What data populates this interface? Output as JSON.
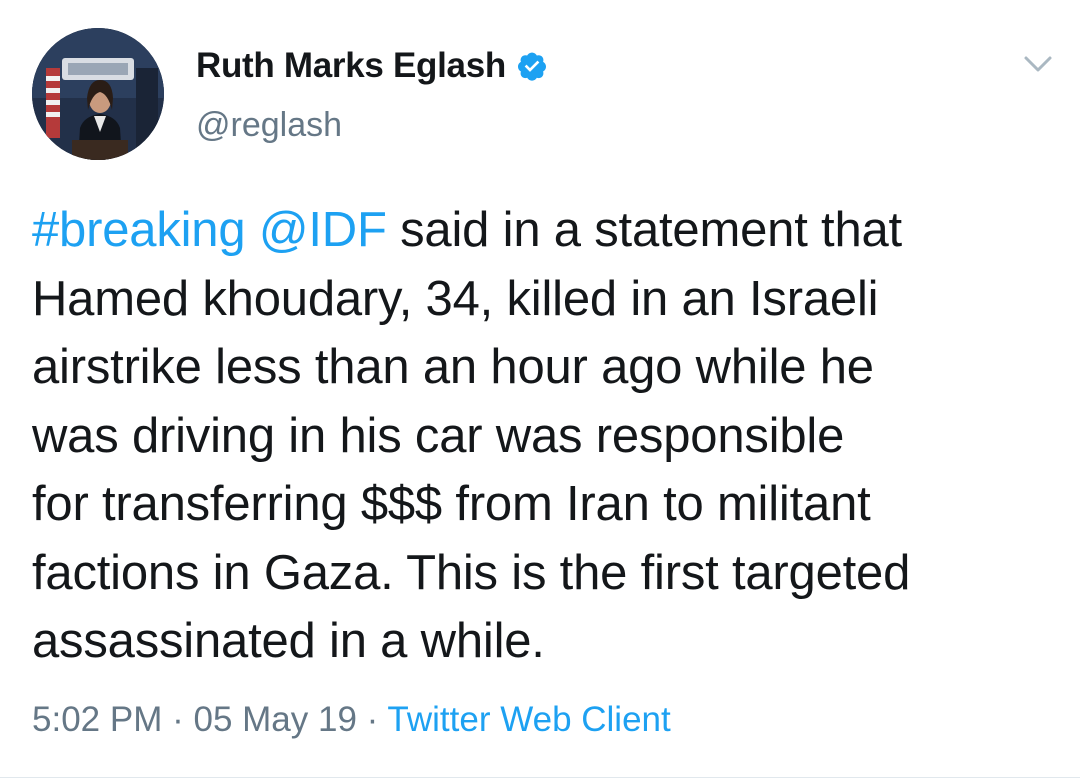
{
  "author": {
    "display_name": "Ruth Marks Eglash",
    "handle": "@reglash",
    "verified": true,
    "avatar_icon": "profile-photo"
  },
  "tweet": {
    "hashtag": "#breaking",
    "mention": "@IDF",
    "lines": [
      " said in a statement that",
      "Hamed khoudary, 34, killed in an Israeli",
      "airstrike less than an hour ago while he",
      "was driving in his car was responsible",
      "for transferring $$$ from Iran to militant",
      "factions in Gaza. This is the first targeted",
      "assassinated in a while."
    ]
  },
  "meta": {
    "time": "5:02 PM",
    "separator": "·",
    "date": "05 May 19",
    "source": "Twitter Web Client"
  },
  "colors": {
    "link": "#1da1f2",
    "text": "#14171a",
    "secondary": "#657786",
    "divider": "#e1e8ed"
  },
  "icons": {
    "verified": "verified-badge-icon",
    "more": "chevron-down-icon"
  }
}
